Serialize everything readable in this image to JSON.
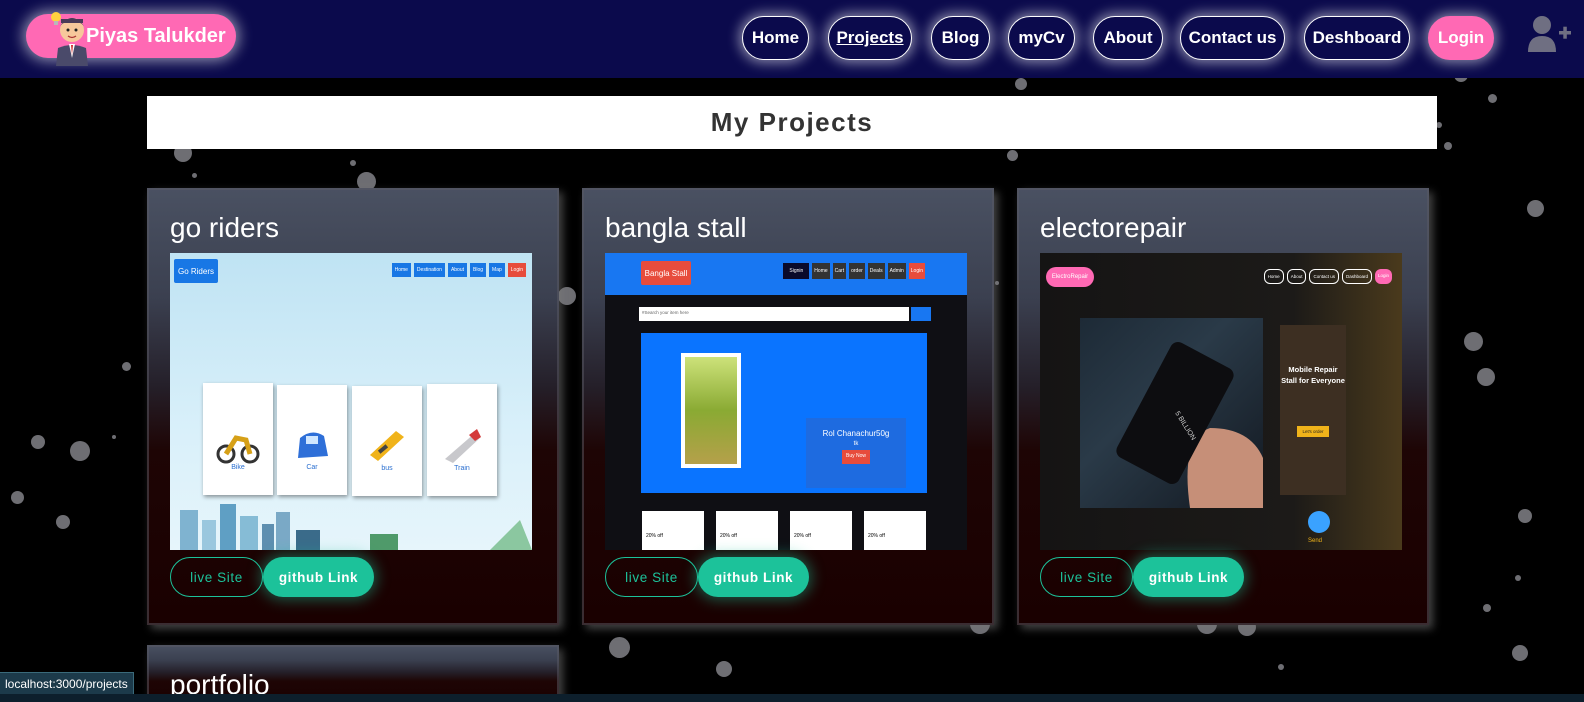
{
  "brand": {
    "name": "Piyas Talukder",
    "colors": {
      "brand": "#ff69b4",
      "nav_bg": "#0b0a4c",
      "accent": "#1cc29a"
    }
  },
  "nav": {
    "items": [
      {
        "label": "Home"
      },
      {
        "label": "Projects",
        "active": true
      },
      {
        "label": "Blog"
      },
      {
        "label": "myCv"
      },
      {
        "label": "About"
      },
      {
        "label": "Contact us"
      },
      {
        "label": "Deshboard"
      },
      {
        "label": "Login"
      }
    ],
    "add_user_icon": "user-plus-icon"
  },
  "page": {
    "title": "My Projects"
  },
  "projects": [
    {
      "name": "go riders",
      "live_label": "live Site",
      "github_label": "github Link",
      "screenshot": {
        "logo": "Go Riders",
        "nav": [
          "Home",
          "Destination",
          "About",
          "Blog",
          "Map",
          "Login"
        ],
        "cards": [
          "Bike",
          "Car",
          "bus",
          "Train"
        ]
      }
    },
    {
      "name": "bangla stall",
      "live_label": "live Site",
      "github_label": "github Link",
      "screenshot": {
        "logo": "Bangla Stall",
        "nav": [
          "Signin",
          "Home",
          "Cart",
          "order",
          "Deals",
          "Admin",
          "Login"
        ],
        "search_placeholder": "#Search your item here",
        "product": "Rol Chanachur50g",
        "price": "tk",
        "buy": "Buy Now",
        "discount": "20% off"
      }
    },
    {
      "name": "electorepair",
      "live_label": "live Site",
      "github_label": "github Link",
      "screenshot": {
        "logo": "ElectroRepair",
        "nav": [
          "Home",
          "About",
          "Contact us",
          "Dashboard",
          "Login"
        ],
        "hero_title": "Mobile Repair Stall for Everyone",
        "hero_cta": "Let's order",
        "phone_text": "5 BILLION",
        "chat": "Send"
      }
    },
    {
      "name": "portfolio"
    }
  ],
  "status_url": "localhost:3000/projects"
}
